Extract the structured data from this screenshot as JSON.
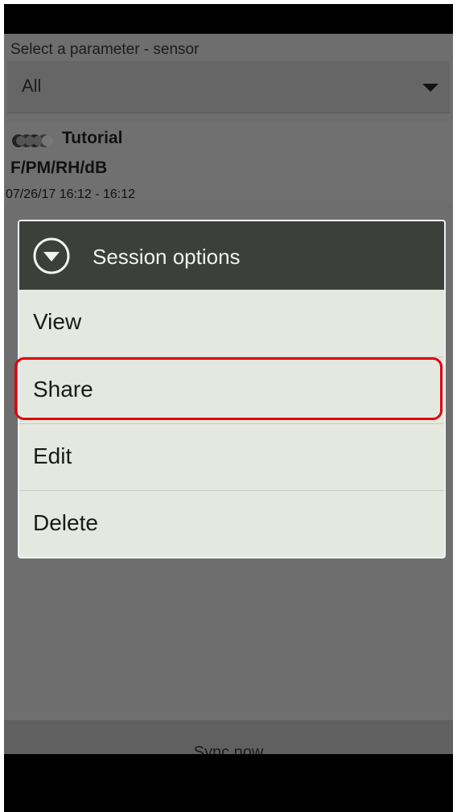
{
  "filter": {
    "label": "Select a parameter - sensor",
    "selected_value": "All"
  },
  "session": {
    "title": "Tutorial",
    "parameters": "F/PM/RH/dB",
    "time_range": "07/26/17 16:12 - 16:12"
  },
  "dialog": {
    "title": "Session options",
    "header_icon": "dropdown-circle-icon",
    "options": [
      {
        "label": "View"
      },
      {
        "label": "Share",
        "highlighted": true
      },
      {
        "label": "Edit"
      },
      {
        "label": "Delete"
      }
    ]
  },
  "footer": {
    "sync_label": "Sync now"
  },
  "colors": {
    "highlight": "#e0000a",
    "dialog_header": "#3c3f3a",
    "dialog_body": "#e4e8e1"
  }
}
